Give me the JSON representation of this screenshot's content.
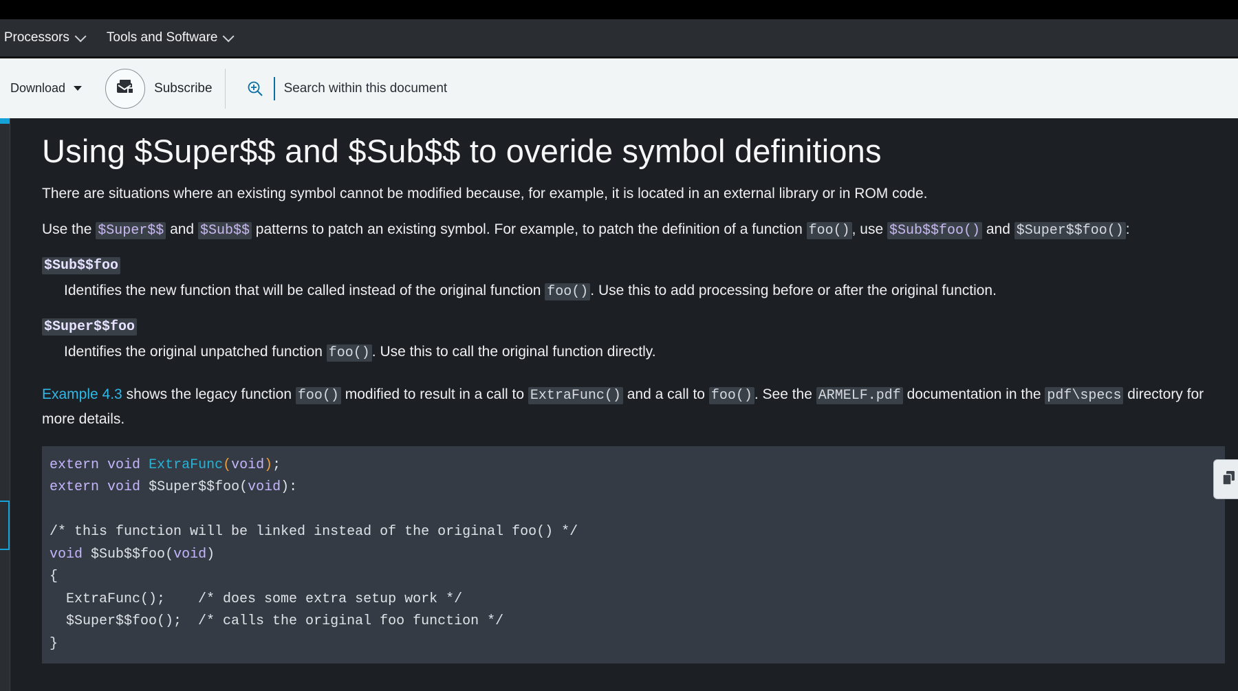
{
  "nav": {
    "items": [
      {
        "label": "d Processors"
      },
      {
        "label": "Tools and Software"
      }
    ]
  },
  "toolbar": {
    "download_label": "Download",
    "subscribe_label": "Subscribe",
    "search_placeholder": "Search within this document"
  },
  "article": {
    "title": "Using $Super$$ and $Sub$$ to overide symbol definitions",
    "p1": "There are situations where an existing symbol cannot be modified because, for example, it is located in an external library or in ROM code.",
    "p2": {
      "t1": "Use the ",
      "c1": "$Super$$",
      "t2": " and ",
      "c2": "$Sub$$",
      "t3": " patterns to patch an existing symbol. For example, to patch the definition of a function ",
      "c3": "foo()",
      "t4": ", use ",
      "c4": "$Sub$$foo()",
      "t5": " and ",
      "c5": "$Super$$foo()",
      "t6": ":"
    },
    "defs": [
      {
        "term": "$Sub$$foo",
        "d1": "Identifies the new function that will be called instead of the original function ",
        "code": "foo()",
        "d2": ". Use this to add processing before or after the original function."
      },
      {
        "term": "$Super$$foo",
        "d1": "Identifies the original unpatched function ",
        "code": "foo()",
        "d2": ". Use this to call the original function directly."
      }
    ],
    "p3": {
      "link": "Example 4.3",
      "t1": " shows the legacy function ",
      "c1": "foo()",
      "t2": " modified to result in a call to ",
      "c2": "ExtraFunc()",
      "t3": " and a call to ",
      "c3": "foo()",
      "t4": ". See the ",
      "c4": "ARMELF.pdf",
      "t5": " documentation in the ",
      "c5": "pdf\\specs",
      "t6": " directory for more details."
    },
    "code": {
      "l1_kw1": "extern",
      "l1_kw2": "void",
      "l1_fn": "ExtraFunc",
      "l1_paren_open": "(",
      "l1_arg": "void",
      "l1_paren_close": ")",
      "l1_end": ";",
      "l2_kw1": "extern",
      "l2_kw2": "void",
      "l2_name": "$Super$$foo",
      "l2_arg": "void",
      "l3": "/* this function will be linked instead of the original foo() */",
      "l4_kw": "void",
      "l4_name": "$Sub$$foo",
      "l4_arg": "void",
      "l5": "{",
      "l6": "  ExtraFunc();    /* does some extra setup work */",
      "l7": "  $Super$$foo();  /* calls the original foo function */",
      "l8": "}"
    }
  },
  "icons": {
    "subscribe": "envelope-icon",
    "search": "zoom-in-icon",
    "copy": "copy-icon"
  }
}
